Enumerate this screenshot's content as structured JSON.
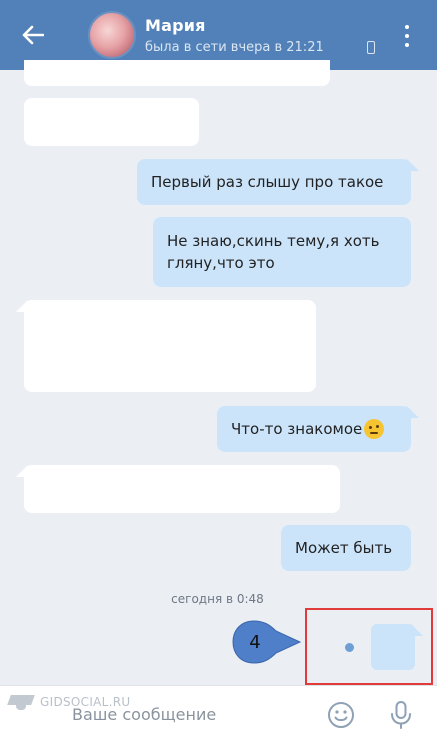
{
  "header": {
    "contact_name": "Мария",
    "status_text": "была в сети вчера в 21:21",
    "back_icon": "arrow-left-icon",
    "menu_icon": "more-vertical-icon"
  },
  "messages": [
    {
      "dir": "in",
      "text": ""
    },
    {
      "dir": "in",
      "text": ""
    },
    {
      "dir": "out",
      "text": "Первый раз слышу про такое"
    },
    {
      "dir": "out",
      "line1": "Не знаю,скинь тему,я хоть",
      "line2": "гляну,что это"
    },
    {
      "dir": "in",
      "text": ""
    },
    {
      "dir": "out",
      "text": "Что-то знакомое",
      "emoji": "thinking-face"
    },
    {
      "dir": "in",
      "text": ""
    },
    {
      "dir": "out",
      "text": "Может быть"
    }
  ],
  "date_separator": "сегодня в 0:48",
  "annotation": {
    "number": "4",
    "highlight_color": "#e03a3a",
    "callout_color": "#4f7fc8"
  },
  "watermark": "GIDSOCIAL.RU",
  "composer": {
    "placeholder": "Ваше сообщение",
    "emoji_icon": "smile-icon",
    "mic_icon": "microphone-icon"
  },
  "colors": {
    "header_bg": "#5181b8",
    "chat_bg": "#ebeff4",
    "outgoing_bubble": "#cce4fa",
    "incoming_bubble": "#ffffff"
  }
}
